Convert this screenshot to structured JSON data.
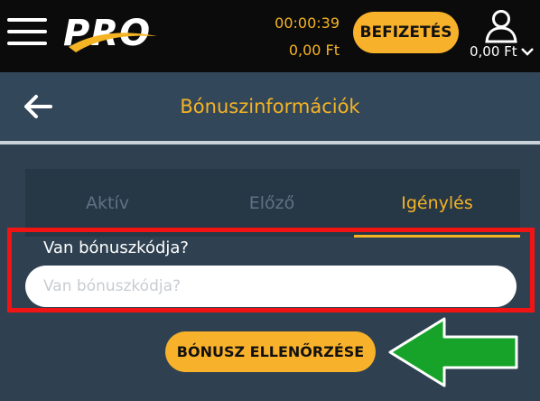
{
  "header": {
    "logo_text": "PRO",
    "timer": "00:00:39",
    "balance": "0,00 Ft",
    "deposit_label": "BEFIZETÉS",
    "account_balance": "0,00 Ft"
  },
  "subheader": {
    "title": "Bónuszinformációk"
  },
  "tabs": [
    {
      "label": "Aktív",
      "active": false
    },
    {
      "label": "Előző",
      "active": false
    },
    {
      "label": "Igénylés",
      "active": true
    }
  ],
  "form": {
    "label": "Van bónuszkódja?",
    "placeholder": "Van bónuszkódja?",
    "button_label": "BÓNUSZ ELLENŐRZÉSE"
  },
  "colors": {
    "accent": "#f5b424",
    "button": "#f8b12a",
    "highlight": "#f01414",
    "arrow": "#17a329"
  },
  "icons": [
    "menu-icon",
    "user-icon",
    "chevron-down-icon",
    "back-arrow-icon"
  ]
}
